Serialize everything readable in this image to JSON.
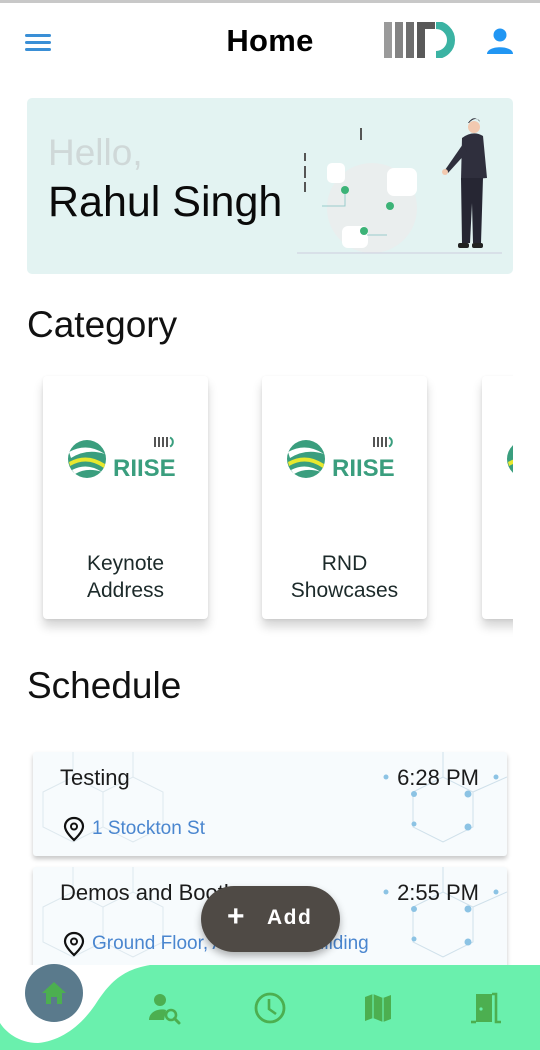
{
  "appbar": {
    "title": "Home",
    "menu_icon": "hamburger-menu-icon",
    "logo": "iiitd-logo",
    "profile_icon": "person-icon"
  },
  "greeting": {
    "hello": "Hello,",
    "name": "Rahul Singh"
  },
  "category": {
    "title": "Category",
    "items": [
      {
        "logo_text": "RIISE",
        "logo_sub": "IIITD",
        "label_line1": "Keynote",
        "label_line2": "Address"
      },
      {
        "logo_text": "RIISE",
        "logo_sub": "IIITD",
        "label_line1": "RND",
        "label_line2": "Showcases"
      },
      {
        "logo_text": "RIISE",
        "logo_sub": "IIITD",
        "label_line1": "",
        "label_line2": ""
      }
    ]
  },
  "schedule": {
    "title": "Schedule",
    "items": [
      {
        "title": "Testing",
        "time": "6:28 PM",
        "location": "1 Stockton St"
      },
      {
        "title": "Demos and Booths",
        "time": "2:55 PM",
        "location": "Ground Floor, Academic Building"
      }
    ]
  },
  "fab": {
    "icon": "+",
    "label": "Add"
  },
  "bottom_nav": {
    "items": [
      {
        "name": "home",
        "icon": "home-icon",
        "active": true
      },
      {
        "name": "people-search",
        "icon": "person-search-icon",
        "active": false
      },
      {
        "name": "schedule",
        "icon": "clock-icon",
        "active": false
      },
      {
        "name": "map",
        "icon": "map-icon",
        "active": false
      },
      {
        "name": "exit",
        "icon": "door-exit-icon",
        "active": false
      }
    ]
  },
  "colors": {
    "accent_blue": "#3a8fd6",
    "banner_bg": "#e3f3f2",
    "nav_green": "#6af0ad",
    "nav_icon_green": "#4caf50",
    "home_circle": "#5a7a8c",
    "fab_bg": "#4f4a45",
    "location_link": "#4a86cf",
    "riise_teal": "#3a9e7e",
    "riise_yellow": "#e8e82e"
  }
}
